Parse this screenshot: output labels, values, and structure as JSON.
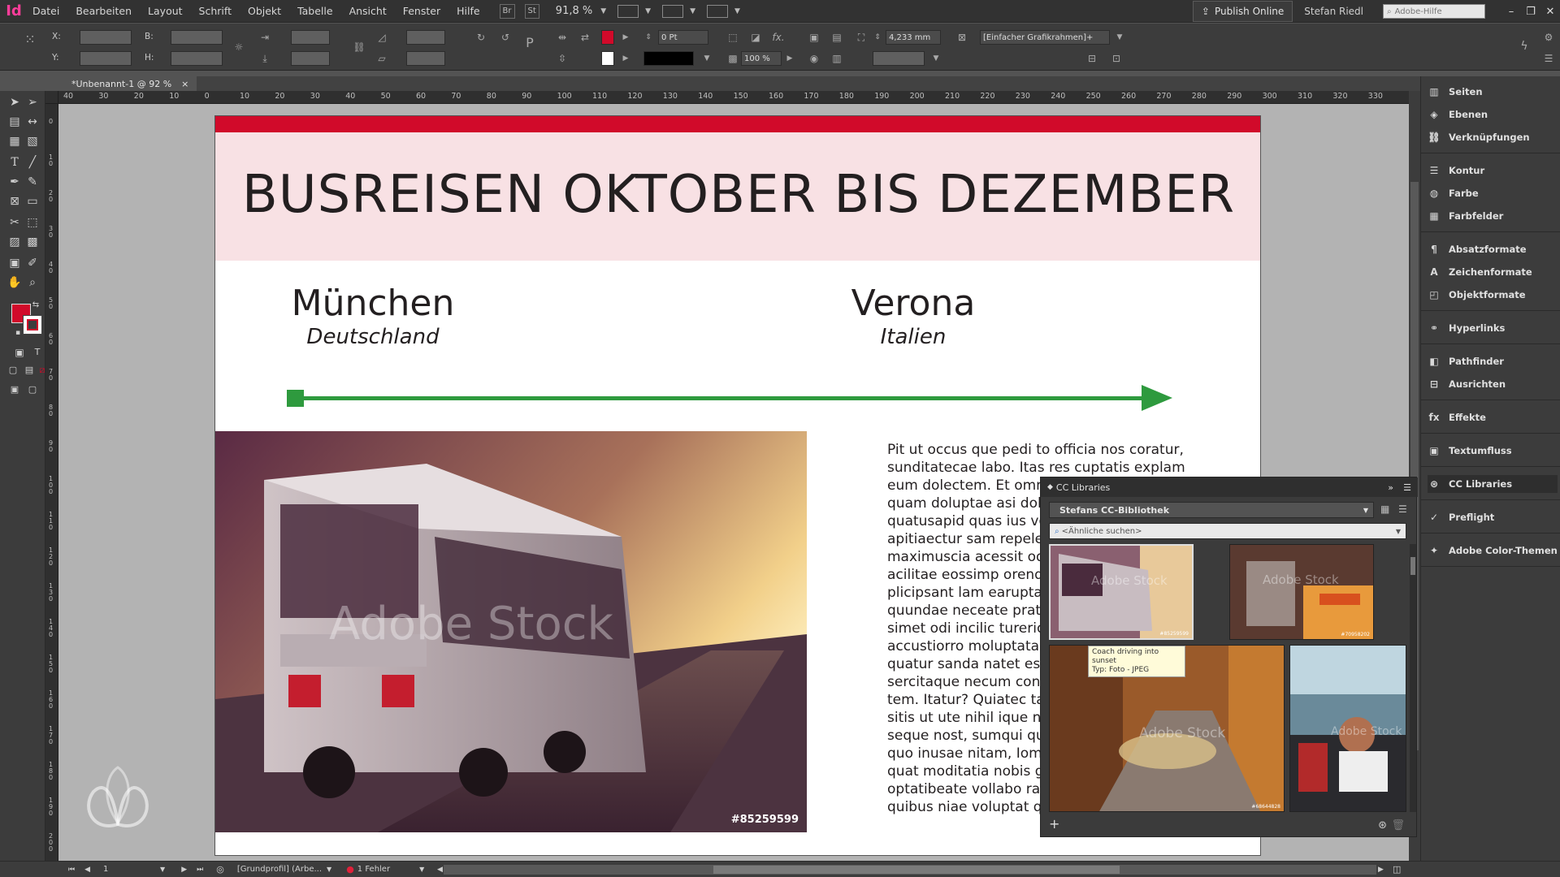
{
  "app": {
    "logo": "Id",
    "menu": [
      "Datei",
      "Bearbeiten",
      "Layout",
      "Schrift",
      "Objekt",
      "Tabelle",
      "Ansicht",
      "Fenster",
      "Hilfe"
    ],
    "bridge_chip": "Br",
    "stock_chip": "St",
    "zoom": "91,8 %",
    "publish_label": "Publish Online",
    "user_name": "Stefan Riedl",
    "help_search_placeholder": "Adobe-Hilfe"
  },
  "control_panel": {
    "x_label": "X:",
    "y_label": "Y:",
    "b_label": "B:",
    "h_label": "H:",
    "stroke_weight": "0 Pt",
    "opacity": "100 %",
    "size_value": "4,233 mm",
    "frame_style": "[Einfacher Grafikrahmen]+",
    "fill_color": "#d10a2a"
  },
  "document_tab": {
    "title": "*Unbenannt-1 @ 92 %",
    "close": "×"
  },
  "ruler_h": [
    "40",
    "30",
    "20",
    "10",
    "0",
    "10",
    "20",
    "30",
    "40",
    "50",
    "60",
    "70",
    "80",
    "90",
    "100",
    "110",
    "120",
    "130",
    "140",
    "150",
    "160",
    "170",
    "180",
    "190",
    "200",
    "210",
    "220",
    "230",
    "240",
    "250",
    "260",
    "270",
    "280",
    "290",
    "300",
    "310",
    "320",
    "330"
  ],
  "ruler_v": [
    "0",
    "1 0",
    "2 0",
    "3 0",
    "4 0",
    "5 0",
    "6 0",
    "7 0",
    "8 0",
    "9 0",
    "1 0 0",
    "1 1 0",
    "1 2 0",
    "1 3 0",
    "1 4 0",
    "1 5 0",
    "1 6 0",
    "1 7 0",
    "1 8 0",
    "1 9 0",
    "2 0 0"
  ],
  "page": {
    "title": "BUSREISEN OKTOBER BIS DEZEMBER",
    "origin_city": "München",
    "origin_country": "Deutschland",
    "destination_city": "Verona",
    "destination_country": "Italien",
    "photo_watermark": "Adobe Stock",
    "photo_id": "#85259599",
    "body_lines": [
      "Pit ut occus que pedi to officia nos coratur,",
      "sunditatecae labo. Itas res cuptatis explam",
      "eum dolectem. Et omni",
      "quam doluptae asi dolor",
      "quatusapid quas ius vol",
      "apitiaectur sam repelen",
      "maximuscia acessit odig",
      "acilitae eossimp orendis",
      "plicipsant lam earuptatu",
      "quundae neceate pratem",
      "simet odi incilic turerion",
      "accustiorro moluptatam",
      "quatur sanda natet es m",
      "sercitaque necum conse",
      "tem. Itatur? Quiatec tass",
      "sitis ut ute nihil ique nin",
      "seque nost, sumqui quat",
      "quo inusae nitam, Iomni",
      "quat moditatia nobis gu",
      "optatibeate vollabo ratis",
      "quibus niae voluptat quo"
    ],
    "accent_red": "#d10a2a",
    "title_band_color": "#f8e1e4",
    "arrow_green": "#2e9a3e"
  },
  "right_dock": {
    "groups": [
      [
        {
          "label": "Seiten",
          "icon": "pages-icon"
        },
        {
          "label": "Ebenen",
          "icon": "layers-icon"
        },
        {
          "label": "Verknüpfungen",
          "icon": "links-icon"
        }
      ],
      [
        {
          "label": "Kontur",
          "icon": "stroke-icon"
        },
        {
          "label": "Farbe",
          "icon": "color-icon"
        },
        {
          "label": "Farbfelder",
          "icon": "swatches-icon"
        }
      ],
      [
        {
          "label": "Absatzformate",
          "icon": "paragraph-styles-icon"
        },
        {
          "label": "Zeichenformate",
          "icon": "character-styles-icon"
        },
        {
          "label": "Objektformate",
          "icon": "object-styles-icon"
        }
      ],
      [
        {
          "label": "Hyperlinks",
          "icon": "hyperlinks-icon"
        }
      ],
      [
        {
          "label": "Pathfinder",
          "icon": "pathfinder-icon"
        },
        {
          "label": "Ausrichten",
          "icon": "align-icon"
        }
      ],
      [
        {
          "label": "Effekte",
          "icon": "effects-icon"
        }
      ],
      [
        {
          "label": "Textumfluss",
          "icon": "text-wrap-icon"
        }
      ],
      [
        {
          "label": "CC Libraries",
          "icon": "cc-libraries-icon"
        }
      ],
      [
        {
          "label": "Preflight",
          "icon": "preflight-icon"
        }
      ],
      [
        {
          "label": "Adobe Color-Themen",
          "icon": "color-themes-icon"
        }
      ]
    ]
  },
  "cc_libraries": {
    "title": "CC Libraries",
    "library": "Stefans CC-Bibliothek",
    "search_placeholder": "<Ähnliche suchen>",
    "thumb_watermark": "Adobe Stock",
    "thumbs": [
      {
        "id": "#85259599",
        "subject": "bus"
      },
      {
        "id": "#70958202",
        "subject": "truck"
      },
      {
        "id": "#68644828",
        "subject": "car"
      },
      {
        "id": "",
        "subject": "passenger"
      }
    ],
    "tooltip_line1": "Coach driving into sunset",
    "tooltip_line2": "Typ: Foto - JPEG"
  },
  "status_bar": {
    "page_number": "1",
    "profile": "[Grundprofil] (Arbe...",
    "errors": "1 Fehler"
  }
}
